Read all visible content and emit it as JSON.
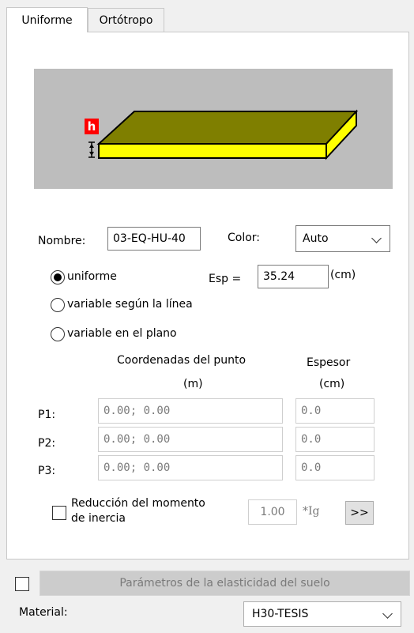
{
  "tabs": [
    {
      "label": "Uniforme",
      "active": true
    },
    {
      "label": "Ortótropo",
      "active": false
    }
  ],
  "preview": {
    "h_label": "h"
  },
  "nombre": {
    "label": "Nombre:",
    "value": "03-EQ-HU-40"
  },
  "color": {
    "label": "Color:",
    "selected": "Auto"
  },
  "radios": {
    "uniforme": {
      "label": "uniforme",
      "checked": true
    },
    "variable_linea": {
      "label": "variable según la línea",
      "checked": false
    },
    "variable_plano": {
      "label": "variable en el plano",
      "checked": false
    }
  },
  "esp": {
    "label": "Esp =",
    "value": "35.24",
    "unit": "(cm)"
  },
  "points": {
    "coord_header_1": "Coordenadas del punto",
    "coord_header_2": "(m)",
    "thick_header_1": "Espesor",
    "thick_header_2": "(cm)",
    "rows": [
      {
        "label": "P1:",
        "coord": "0.00; 0.00",
        "thickness": "0.0"
      },
      {
        "label": "P2:",
        "coord": "0.00; 0.00",
        "thickness": "0.0"
      },
      {
        "label": "P3:",
        "coord": "0.00; 0.00",
        "thickness": "0.0"
      }
    ]
  },
  "reduccion": {
    "label_line1": "Reducción del momento",
    "label_line2": "de inercia",
    "checked": false,
    "value": "1.00",
    "unit": "*Ig",
    "button": ">>"
  },
  "suelo": {
    "checked": false,
    "button": "Parámetros de la elasticidad del suelo"
  },
  "material": {
    "label": "Material:",
    "selected": "H30-TESIS"
  },
  "colors": {
    "slab_top": "#7f7f00",
    "slab_edge": "#ffff00",
    "h_label_bg": "#ff0000",
    "preview_bg": "#bdbdbd"
  }
}
